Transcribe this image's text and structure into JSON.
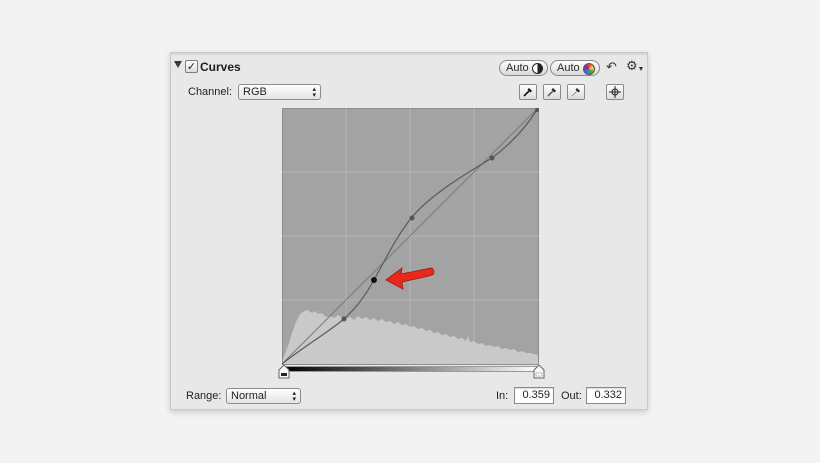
{
  "panel": {
    "title": "Curves",
    "enabled": true,
    "checkmark": "✓",
    "auto_luminance_label": "Auto",
    "auto_color_label": "Auto",
    "undo_icon_glyph": "↶",
    "gear_icon_glyph": "⚙"
  },
  "channel": {
    "label": "Channel:",
    "value": "RGB",
    "arrows": "▲\n▼"
  },
  "tools": [
    "black-point-eyedropper-icon",
    "gray-point-eyedropper-icon",
    "white-point-eyedropper-icon",
    "crosshair-add-point-icon"
  ],
  "range": {
    "label": "Range:",
    "value": "Normal",
    "arrows": "▲\n▼"
  },
  "in": {
    "label": "In:",
    "value": "0.359"
  },
  "out": {
    "label": "Out:",
    "value": "0.332"
  },
  "curve": {
    "points": [
      {
        "in": 0.0,
        "out": 0.0
      },
      {
        "in": 0.24,
        "out": 0.17
      },
      {
        "in": 0.359,
        "out": 0.332
      },
      {
        "in": 0.5,
        "out": 0.56
      },
      {
        "in": 0.82,
        "out": 0.8
      },
      {
        "in": 1.0,
        "out": 1.0
      }
    ],
    "selected_index": 2
  },
  "colors": {
    "grid_background": "#a3a3a3",
    "histogram_fill": "#c9c9c9",
    "arrow_annotation": "#e8291c"
  }
}
